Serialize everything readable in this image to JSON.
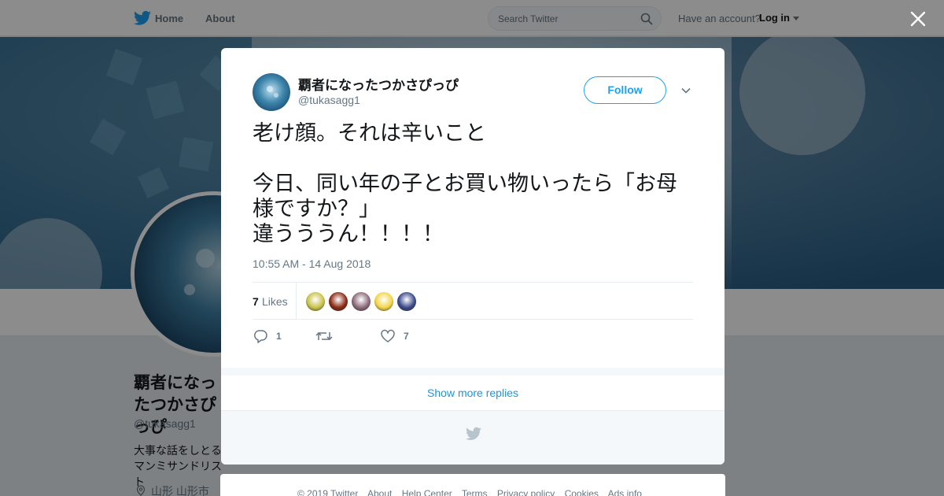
{
  "nav": {
    "home_label": "Home",
    "about_label": "About",
    "search_placeholder": "Search Twitter",
    "have_account": "Have an account?",
    "login_label": "Log in"
  },
  "profile": {
    "name": "覇者になったつかさぴっぴ",
    "handle": "@tukasagg1",
    "bio": "大事な話をしとるマンミサンドリスト",
    "location": "山形 山形市"
  },
  "tweet": {
    "author_name": "覇者になったつかさぴっぴ",
    "author_handle": "@tukasagg1",
    "follow_label": "Follow",
    "text": "老け顔。それは辛いこと\n\n今日、同い年の子とお買い物いったら「お母様ですか？」\n違うううん！！！！",
    "timestamp": "10:55 AM - 14 Aug 2018",
    "likes_count": "7",
    "likes_label": "Likes",
    "reply_count": "1",
    "retweet_count": "",
    "like_count": "7",
    "likers": [
      {
        "color": "#c8c24a"
      },
      {
        "color": "#8a2a14"
      },
      {
        "color": "#8c6a7a"
      },
      {
        "color": "#f2d64a"
      },
      {
        "color": "#3a4a8a"
      }
    ]
  },
  "show_more_label": "Show more replies",
  "footer": {
    "links": [
      "© 2019 Twitter",
      "About",
      "Help Center",
      "Terms",
      "Privacy policy",
      "Cookies",
      "Ads info"
    ]
  },
  "colors": {
    "accent": "#1da1f2",
    "link": "#1b95e0",
    "muted": "#657786"
  }
}
